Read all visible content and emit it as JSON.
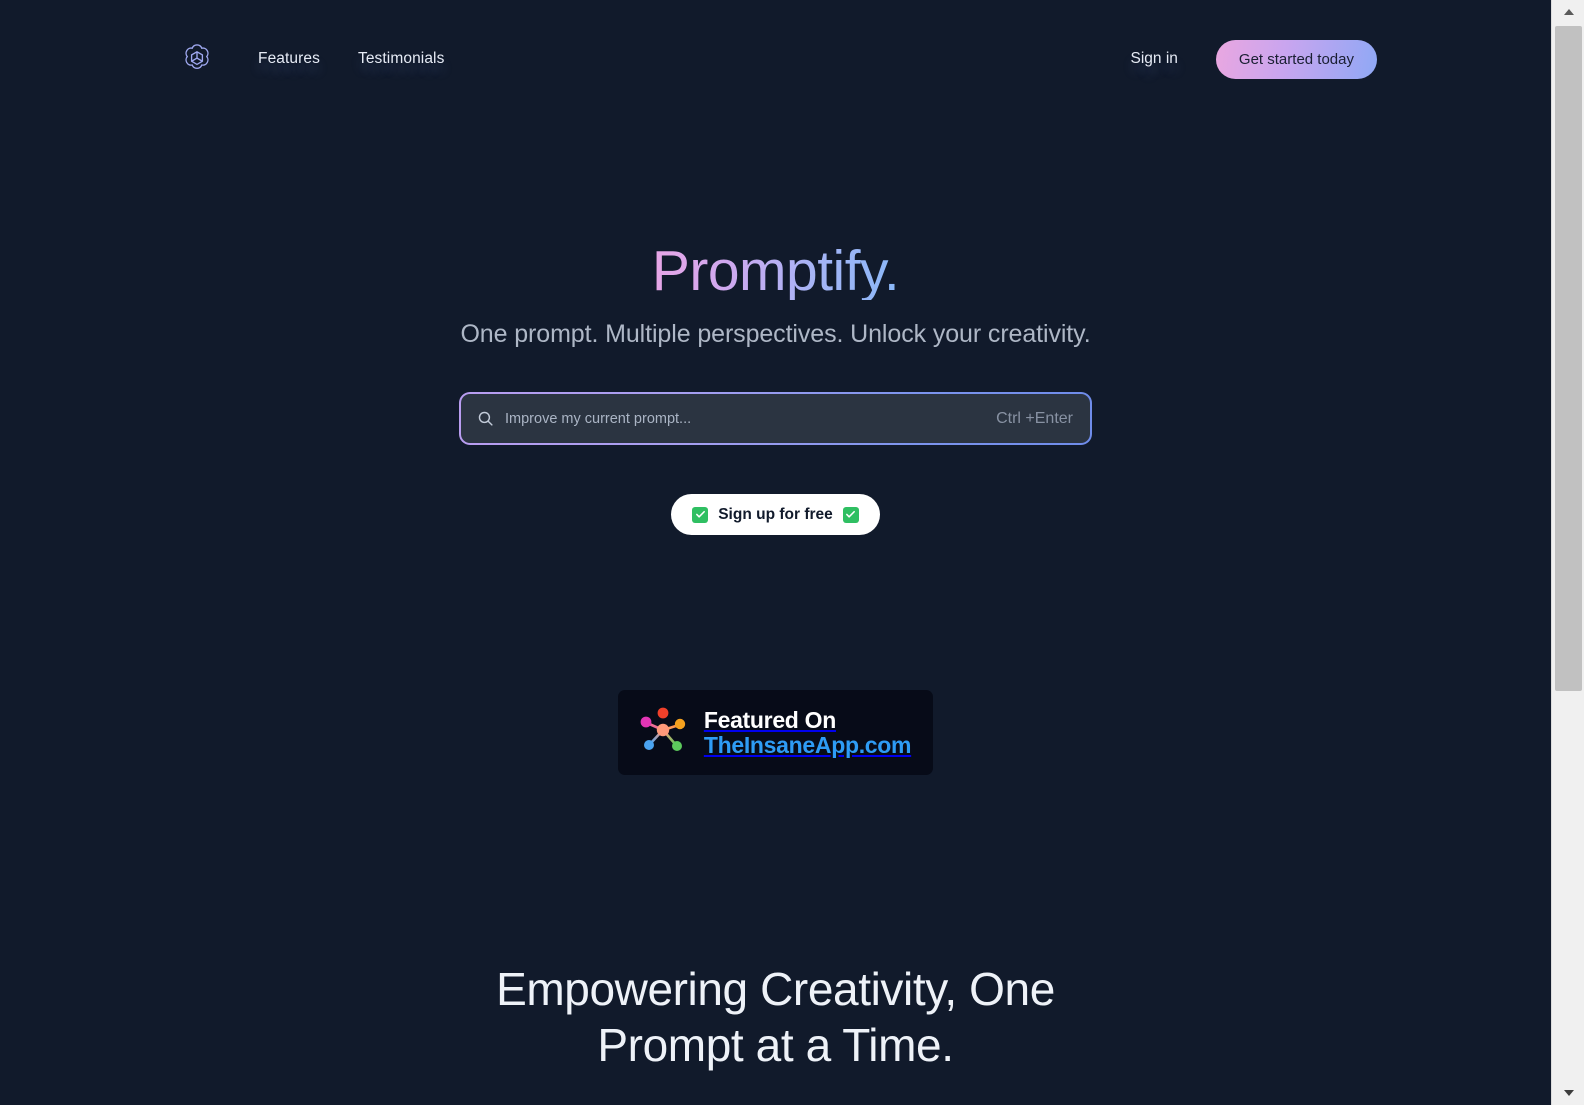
{
  "header": {
    "logo_icon": "openai-flower-logo",
    "nav": [
      {
        "label": "Features"
      },
      {
        "label": "Testimonials"
      }
    ],
    "signin_label": "Sign in",
    "cta_label": "Get started today",
    "cta_gradient_from": "#eaa7e0",
    "cta_gradient_to": "#8fa8f5"
  },
  "hero": {
    "title": "Promptify.",
    "title_gradient_from": "#e8a6e6",
    "title_gradient_to": "#8ab8f8",
    "subtitle": "One prompt. Multiple perspectives. Unlock your creativity."
  },
  "search": {
    "icon": "search-icon",
    "value": "",
    "placeholder": "Improve my current prompt...",
    "shortcut_hint": "Ctrl +Enter",
    "border_gradient_from": "#b99df0",
    "border_gradient_to": "#6f8cea",
    "field_background": "#2b3441"
  },
  "signup": {
    "label": "Sign up for free",
    "left_icon": "check-mark-icon",
    "right_icon": "check-mark-icon",
    "check_color": "#2fbf62",
    "background": "#ffffff"
  },
  "featured_badge": {
    "icon": "molecule-network-icon",
    "line1": "Featured On",
    "line2": "TheInsaneApp.com",
    "line2_color": "#2e9cf5",
    "background": "#070b18"
  },
  "section": {
    "heading_line1": "Empowering Creativity, One",
    "heading_line2": "Prompt at a Time."
  },
  "page": {
    "background": "#111a2b"
  },
  "scrollbar": {
    "up_arrow": "scroll-up-arrow-icon",
    "down_arrow": "scroll-down-arrow-icon",
    "track_color": "#f0f0f0",
    "thumb_color": "#c1c1c1"
  }
}
